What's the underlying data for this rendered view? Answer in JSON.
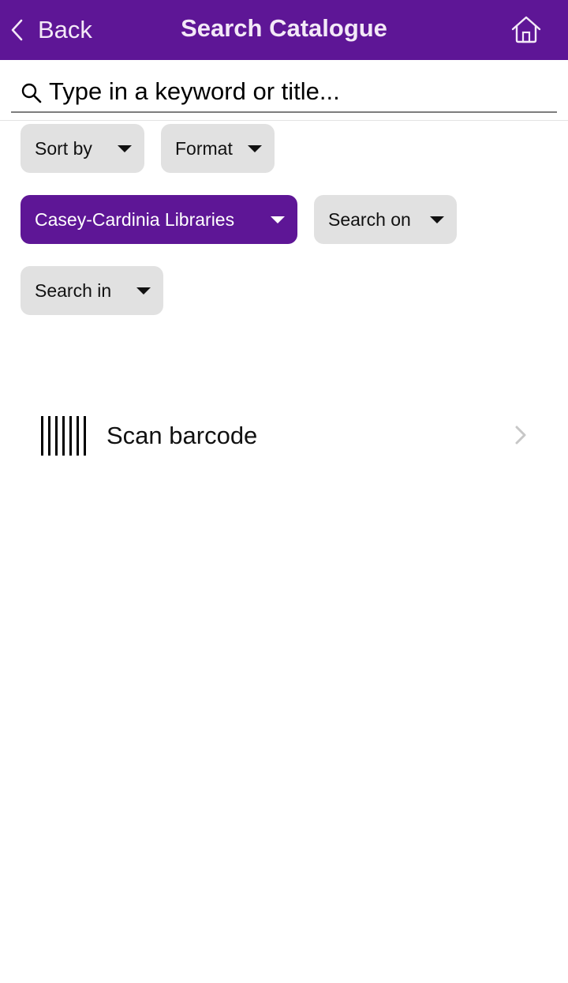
{
  "colors": {
    "brand": "#5e1696",
    "nav_text": "#f3e9f7",
    "chip_bg": "#e1e1e1",
    "chevron": "#c7c7c7"
  },
  "navbar": {
    "back_label": "Back",
    "title": "Search Catalogue",
    "home_icon": "home-icon",
    "back_icon": "chevron-left-icon"
  },
  "search": {
    "value": "",
    "placeholder": "Type in a keyword or title...",
    "icon": "search-icon"
  },
  "filters": [
    {
      "label": "Sort by",
      "active": false
    },
    {
      "label": "Format",
      "active": false
    },
    {
      "label": "Casey-Cardinia Libraries",
      "active": true
    },
    {
      "label": "Search on",
      "active": false
    },
    {
      "label": "Search in",
      "active": false
    }
  ],
  "scan": {
    "label": "Scan barcode",
    "icon": "barcode-icon",
    "chevron_icon": "chevron-right-icon"
  }
}
